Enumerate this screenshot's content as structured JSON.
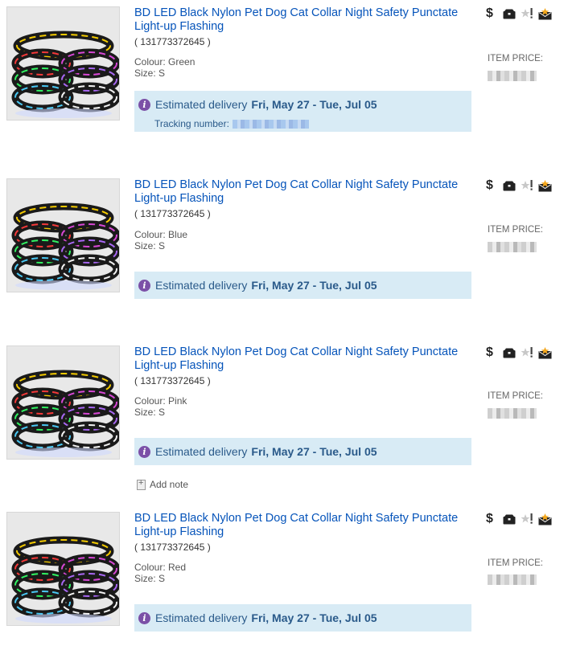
{
  "items": [
    {
      "title": "BD LED Black Nylon Pet Dog Cat Collar Night Safety Punctate Light-up Flashing",
      "item_number": "( 131773372645 )",
      "colour": "Colour: Green",
      "size": "Size: S",
      "estimated_label": "Estimated delivery",
      "estimated_dates": "Fri, May 27 - Tue, Jul 05",
      "tracking_label": "Tracking number:",
      "price_label": "ITEM PRICE:"
    },
    {
      "title": "BD LED Black Nylon Pet Dog Cat Collar Night Safety Punctate Light-up Flashing",
      "item_number": "( 131773372645 )",
      "colour": "Colour: Blue",
      "size": "Size: S",
      "estimated_label": "Estimated delivery",
      "estimated_dates": "Fri, May 27 - Tue, Jul 05",
      "price_label": "ITEM PRICE:"
    },
    {
      "title": "BD LED Black Nylon Pet Dog Cat Collar Night Safety Punctate Light-up Flashing",
      "item_number": "( 131773372645 )",
      "colour": "Colour: Pink",
      "size": "Size: S",
      "estimated_label": "Estimated delivery",
      "estimated_dates": "Fri, May 27 - Tue, Jul 05",
      "price_label": "ITEM PRICE:"
    },
    {
      "title": "BD LED Black Nylon Pet Dog Cat Collar Night Safety Punctate Light-up Flashing",
      "item_number": "( 131773372645 )",
      "colour": "Colour: Red",
      "size": "Size: S",
      "estimated_label": "Estimated delivery",
      "estimated_dates": "Fri, May 27 - Tue, Jul 05",
      "price_label": "ITEM PRICE:"
    }
  ],
  "add_note_label": "Add note",
  "icons": [
    "dollar-icon",
    "shipped-box-icon",
    "feedback-left-icon",
    "feedback-received-icon"
  ],
  "colors": {
    "link": "#0654ba",
    "delivery_bg": "#d8ebf5",
    "info_icon": "#7b50a7"
  }
}
